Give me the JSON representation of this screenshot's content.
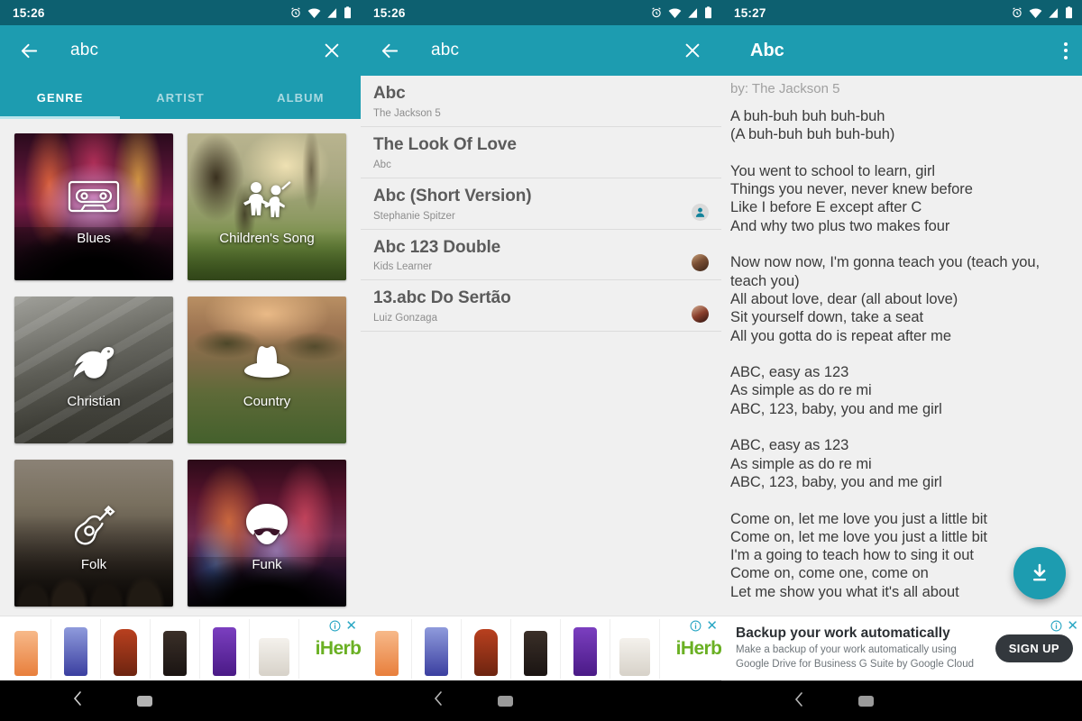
{
  "panels": {
    "genre": {
      "status": {
        "time": "15:26"
      },
      "appbar": {
        "search_value": "abc",
        "back_icon": "back-arrow-icon",
        "clear_icon": "close-icon"
      },
      "tabs": [
        {
          "label": "GENRE",
          "active": true
        },
        {
          "label": "ARTIST",
          "active": false
        },
        {
          "label": "ALBUM",
          "active": false
        }
      ],
      "genres": [
        {
          "label": "Blues",
          "icon": "cassette-tape-icon"
        },
        {
          "label": "Children's Song",
          "icon": "children-playing-icon"
        },
        {
          "label": "Christian",
          "icon": "dove-icon"
        },
        {
          "label": "Country",
          "icon": "cowboy-hat-icon"
        },
        {
          "label": "Folk",
          "icon": "acoustic-guitar-icon"
        },
        {
          "label": "Funk",
          "icon": "afro-sunglasses-icon"
        }
      ],
      "ad": {
        "brand": "iHerb",
        "info_icon": "ad-info-icon",
        "close_icon": "ad-close-icon"
      }
    },
    "results": {
      "status": {
        "time": "15:26"
      },
      "appbar": {
        "search_value": "abc",
        "back_icon": "back-arrow-icon",
        "clear_icon": "close-icon"
      },
      "items": [
        {
          "title": "Abc",
          "subtitle": "The Jackson 5",
          "avatar": "none"
        },
        {
          "title": "The Look Of Love",
          "subtitle": "Abc",
          "avatar": "none"
        },
        {
          "title": "Abc (Short Version)",
          "subtitle": "Stephanie Spitzer",
          "avatar": "person-icon"
        },
        {
          "title": "Abc 123 Double",
          "subtitle": "Kids Learner",
          "avatar": "photo-a"
        },
        {
          "title": "13.abc Do Sertão",
          "subtitle": "Luiz Gonzaga",
          "avatar": "photo-b"
        }
      ],
      "ad": {
        "brand": "iHerb",
        "info_icon": "ad-info-icon",
        "close_icon": "ad-close-icon"
      }
    },
    "lyrics": {
      "status": {
        "time": "15:27"
      },
      "appbar": {
        "title": "Abc",
        "overflow_icon": "overflow-menu-icon"
      },
      "by_label": "by:",
      "artist": "The Jackson 5",
      "text": "A buh-buh buh buh-buh\n(A buh-buh buh buh-buh)\n\nYou went to school to learn, girl\nThings you never, never knew before\nLike I before E except after C\nAnd why two plus two makes four\n\nNow now now, I'm gonna teach you (teach you,\nteach you)\nAll about love, dear (all about love)\nSit yourself down, take a seat\nAll you gotta do is repeat after me\n\nABC, easy as 123\nAs simple as do re mi\nABC, 123, baby, you and me girl\n\nABC, easy as 123\nAs simple as do re mi\nABC, 123, baby, you and me girl\n\nCome on, let me love you just a little bit\nCome on, let me love you just a little bit\nI'm a going to teach how to sing it out\nCome on, come one, come on\nLet me show you what it's all about",
      "fab": {
        "icon": "download-icon"
      },
      "ad": {
        "headline": "Backup your work automatically",
        "line1": "Make a backup of your work automatically using",
        "line2": "Google Drive for Business G Suite by Google Cloud",
        "cta": "SIGN UP",
        "info_icon": "ad-info-icon",
        "close_icon": "ad-close-icon"
      }
    }
  },
  "navbar": {
    "back_icon": "nav-back-icon",
    "home_icon": "nav-home-pill-icon"
  },
  "colors": {
    "appbar_teal": "#1d9cb0",
    "status_teal": "#0d6070",
    "background": "#f0f0f0",
    "accent": "#2aa7c4"
  },
  "ad_products": [
    {
      "name": "orange-scrub-tube",
      "color": "#f2a36a"
    },
    {
      "name": "blue-shampoo-bottle",
      "color": "#5b63c4"
    },
    {
      "name": "honey-bottle",
      "color": "#b03a1f"
    },
    {
      "name": "lavender-oil-bottle",
      "color": "#2a2320"
    },
    {
      "name": "purple-pyure-bottle",
      "color": "#6b2fa8"
    },
    {
      "name": "coconut-oil-jar",
      "color": "#e8e4de"
    }
  ]
}
